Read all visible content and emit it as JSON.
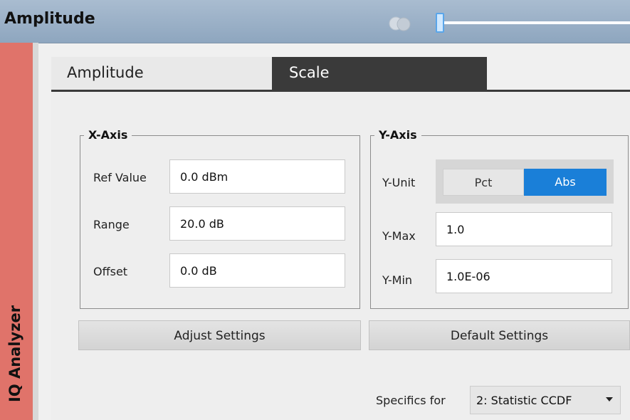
{
  "window": {
    "title": "Amplitude",
    "side_label": "IQ Analyzer"
  },
  "tabs": [
    {
      "label": "Amplitude",
      "active": false
    },
    {
      "label": "Scale",
      "active": true
    }
  ],
  "x_axis": {
    "title": "X-Axis",
    "fields": [
      {
        "label": "Ref Value",
        "value": "0.0 dBm"
      },
      {
        "label": "Range",
        "value": "20.0 dB"
      },
      {
        "label": "Offset",
        "value": "0.0 dB"
      }
    ]
  },
  "y_axis": {
    "title": "Y-Axis",
    "unit_label": "Y-Unit",
    "unit_options": [
      {
        "label": "Pct",
        "selected": false
      },
      {
        "label": "Abs",
        "selected": true
      }
    ],
    "fields": [
      {
        "label": "Y-Max",
        "value": "1.0"
      },
      {
        "label": "Y-Min",
        "value": "1.0E-06"
      }
    ]
  },
  "buttons": {
    "adjust": "Adjust Settings",
    "default": "Default Settings"
  },
  "specifics": {
    "label": "Specifics for",
    "selected": "2: Statistic CCDF"
  },
  "colors": {
    "side_bar": "#e0736a",
    "title_bar": "#98aec6",
    "active_tab": "#3a3a3a",
    "selected_unit": "#1a7fd8"
  }
}
